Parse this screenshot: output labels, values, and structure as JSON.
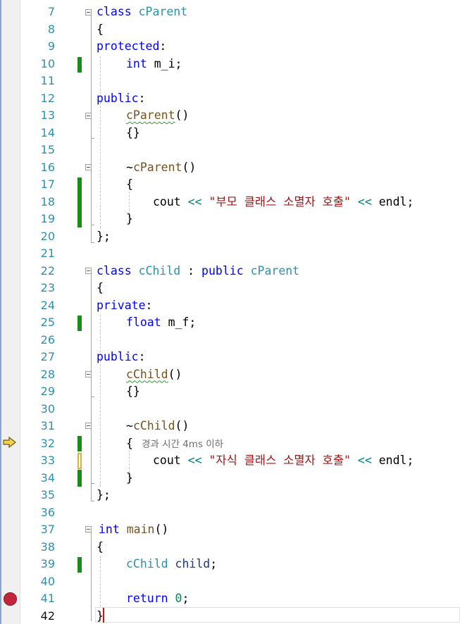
{
  "editor": {
    "line_numbers": [
      "7",
      "8",
      "9",
      "10",
      "11",
      "12",
      "13",
      "14",
      "15",
      "16",
      "17",
      "18",
      "19",
      "20",
      "21",
      "22",
      "23",
      "24",
      "25",
      "26",
      "27",
      "28",
      "29",
      "30",
      "31",
      "32",
      "33",
      "34",
      "35",
      "36",
      "37",
      "38",
      "39",
      "40",
      "41",
      "42"
    ],
    "current_line": "42",
    "perf_tip": "경과 시간 4ms 이하",
    "execution_arrow_line": "32",
    "breakpoint_line": "41",
    "colors": {
      "breakpoint": "#c5253b",
      "change_bar": "#1a8a1a",
      "arrow": "#f2d14c"
    },
    "code": {
      "l7": {
        "kw": "class",
        "name": "cParent"
      },
      "l8": {
        "t": "{"
      },
      "l9": {
        "kw": "protected",
        "p": ":"
      },
      "l10": {
        "kw": "int",
        "rest": " m_i;"
      },
      "l12": {
        "kw": "public",
        "p": ":"
      },
      "l13": {
        "fn": "cParent",
        "p": "()"
      },
      "l14": {
        "t": "{}"
      },
      "l16": {
        "p1": "~",
        "fn": "cParent",
        "p2": "()"
      },
      "l17": {
        "t": "{"
      },
      "l18": {
        "a": "cout",
        "op1": " << ",
        "str": "\"부모 클래스 소멸자 호출\"",
        "op2": " << ",
        "b": "endl;"
      },
      "l19": {
        "t": "}"
      },
      "l20": {
        "t": "};"
      },
      "l22": {
        "kw": "class",
        "name": "cChild",
        "p": " : ",
        "kw2": "public",
        "base": "cParent"
      },
      "l23": {
        "t": "{"
      },
      "l24": {
        "kw": "private",
        "p": ":"
      },
      "l25": {
        "kw": "float",
        "rest": " m_f;"
      },
      "l27": {
        "kw": "public",
        "p": ":"
      },
      "l28": {
        "fn": "cChild",
        "p": "()"
      },
      "l29": {
        "t": "{}"
      },
      "l31": {
        "p1": "~",
        "fn": "cChild",
        "p2": "()"
      },
      "l32": {
        "t": "{"
      },
      "l33": {
        "a": "cout",
        "op1": " << ",
        "str": "\"자식 클래스 소멸자 호출\"",
        "op2": " << ",
        "b": "endl;"
      },
      "l34": {
        "t": "}"
      },
      "l35": {
        "t": "};"
      },
      "l37": {
        "kw": "int",
        "fn": "main",
        "p": "()"
      },
      "l38": {
        "t": "{"
      },
      "l39": {
        "ty": "cChild",
        "id": "child",
        "p": ";"
      },
      "l41": {
        "kw": "return",
        "num": "0",
        "p": ";"
      },
      "l42": {
        "t": "}"
      }
    }
  }
}
